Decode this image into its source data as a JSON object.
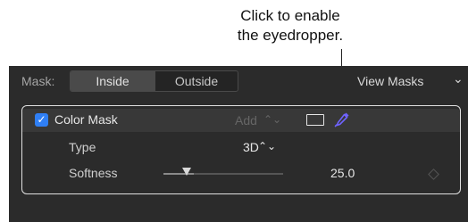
{
  "callout": {
    "line1": "Click to enable",
    "line2": "the eyedropper."
  },
  "mask_bar": {
    "label": "Mask:",
    "segments": [
      {
        "label": "Inside",
        "selected": true
      },
      {
        "label": "Outside",
        "selected": false
      }
    ],
    "view_masks_label": "View Masks",
    "view_masks_chevron": "⌄"
  },
  "color_mask": {
    "checked": true,
    "check_glyph": "✓",
    "label": "Color Mask",
    "add_label": "Add",
    "add_chevron": "⌃⌄",
    "icons": [
      "rectangle-icon",
      "eyedropper-icon"
    ],
    "eyedropper_color": "#6f63ff"
  },
  "type_row": {
    "label": "Type",
    "value": "3D",
    "chevron": "⌃⌄"
  },
  "softness_row": {
    "label": "Softness",
    "value": "25.0",
    "slider_fraction": 0.25
  },
  "colors": {
    "panel_bg": "#2b2b2b",
    "accent_checkbox": "#2f7ff5",
    "box_border": "#e0e0e0"
  }
}
